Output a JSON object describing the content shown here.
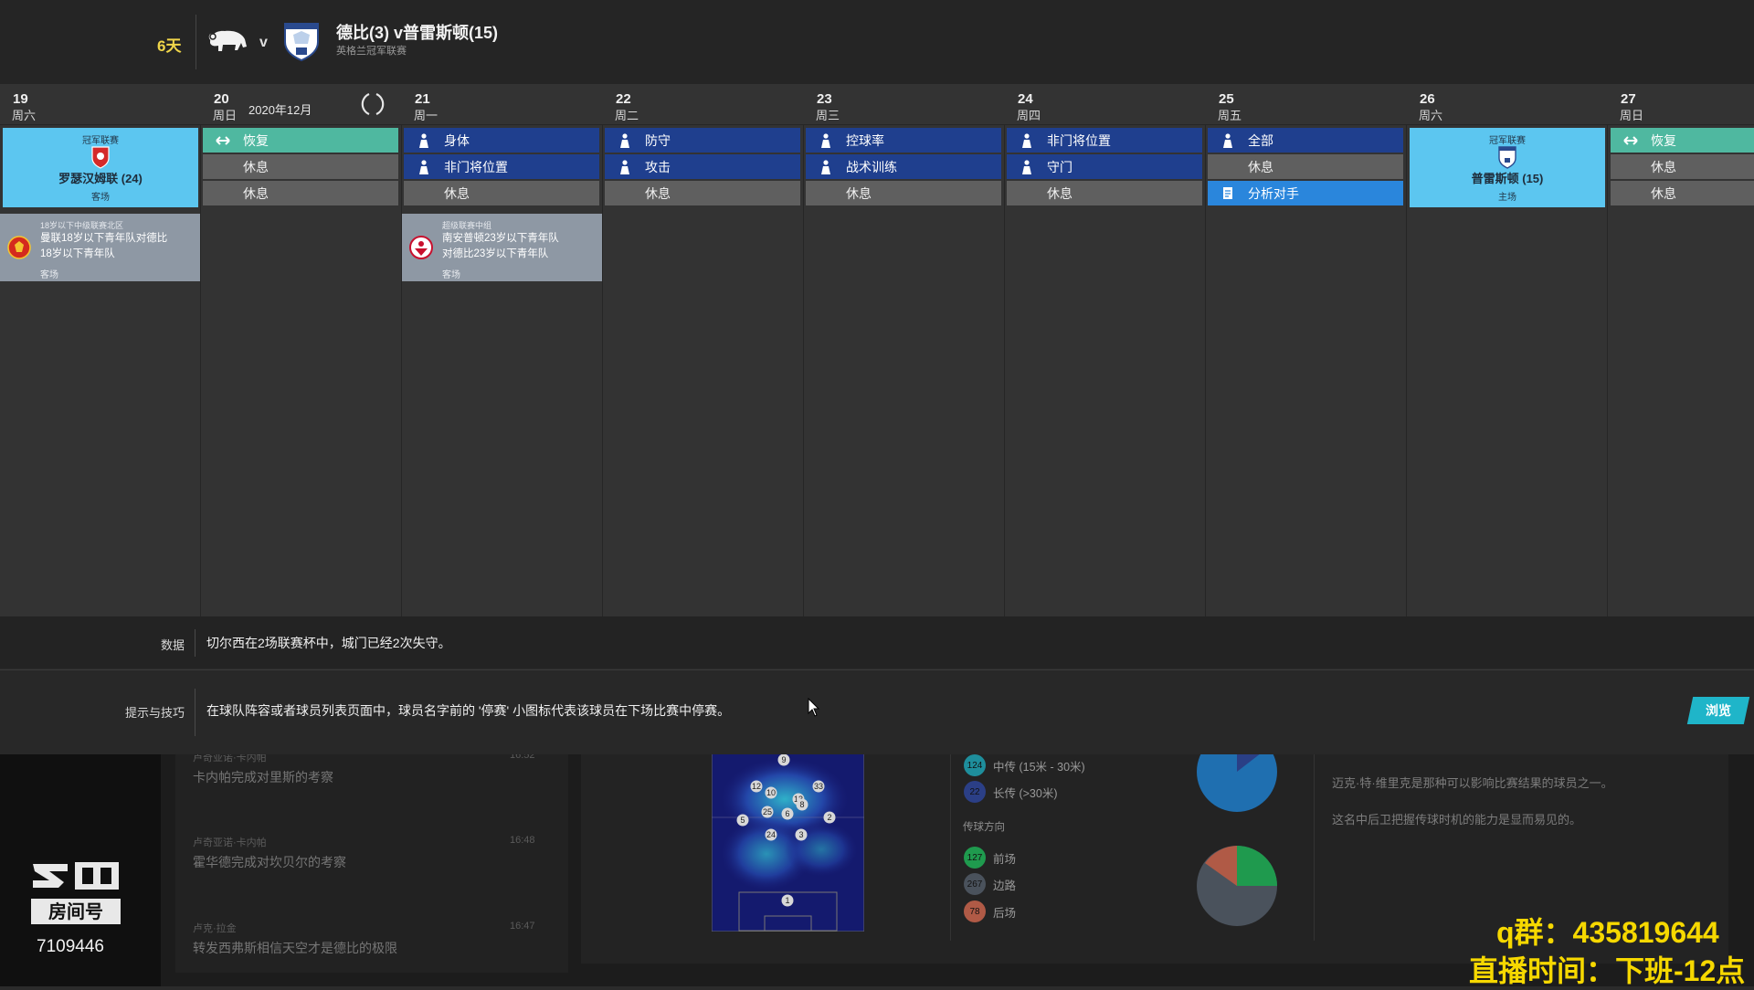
{
  "header": {
    "days_left": "6天",
    "vs": "v",
    "match_title": "德比(3) v普雷斯顿(15)",
    "competition": "英格兰冠军联赛"
  },
  "calendar": {
    "month": "2020年12月",
    "days": [
      {
        "num": "19",
        "weekday": "周六"
      },
      {
        "num": "20",
        "weekday": "周日"
      },
      {
        "num": "21",
        "weekday": "周一"
      },
      {
        "num": "22",
        "weekday": "周二"
      },
      {
        "num": "23",
        "weekday": "周三"
      },
      {
        "num": "24",
        "weekday": "周四"
      },
      {
        "num": "25",
        "weekday": "周五"
      },
      {
        "num": "26",
        "weekday": "周六"
      },
      {
        "num": "27",
        "weekday": "周日"
      }
    ],
    "match_19": {
      "comp": "冠军联赛",
      "opponent": "罗瑟汉姆联 (24)",
      "venue": "客场"
    },
    "match_26": {
      "comp": "冠军联赛",
      "opponent": "普雷斯顿 (15)",
      "venue": "主场"
    },
    "day20": [
      "恢复",
      "休息",
      "休息"
    ],
    "day21": [
      "身体",
      "非门将位置",
      "休息"
    ],
    "day22": [
      "防守",
      "攻击",
      "休息"
    ],
    "day23": [
      "控球率",
      "战术训练",
      "休息"
    ],
    "day24": [
      "非门将位置",
      "守门",
      "休息"
    ],
    "day25": [
      "全部",
      "休息",
      "分析对手"
    ],
    "day27": [
      "恢复",
      "休息",
      "休息"
    ],
    "youth_19": {
      "comp": "18岁以下中级联赛北区",
      "line1": "曼联18岁以下青年队对德比",
      "line2": "18岁以下青年队",
      "venue": "客场"
    },
    "youth_21": {
      "comp": "超级联赛中组",
      "line1": "南安普顿23岁以下青年队",
      "line2": "对德比23岁以下青年队",
      "venue": "客场"
    }
  },
  "data_bar": {
    "label": "数据",
    "text": "切尔西在2场联赛杯中，城门已经2次失守。"
  },
  "tips_bar": {
    "label": "提示与技巧",
    "text": "在球队阵容或者球员列表页面中，球员名字前的 '停赛' 小图标代表该球员在下场比赛中停赛。",
    "browse": "浏览"
  },
  "background": {
    "news": [
      {
        "source": "卢奇亚诺·卡内帕",
        "text": "卡内帕完成对里斯的考察",
        "time": "16:52"
      },
      {
        "source": "卢奇亚诺·卡内帕",
        "text": "霍华德完成对坎贝尔的考察",
        "time": "16:48"
      },
      {
        "source": "卢克·拉金",
        "text": "转发西弗斯相信天空才是德比的极限",
        "time": "16:47"
      }
    ],
    "pass_stats": [
      {
        "num": "124",
        "label": "中传 (15米 - 30米)",
        "color": "#1e8e9c"
      },
      {
        "num": "22",
        "label": "长传 (>30米)",
        "color": "#2b3f86"
      }
    ],
    "direction_head": "传球方向",
    "direction_stats": [
      {
        "num": "127",
        "label": "前场",
        "color": "#1f9a4e"
      },
      {
        "num": "267",
        "label": "边路",
        "color": "#4a525c"
      },
      {
        "num": "78",
        "label": "后场",
        "color": "#b05a46"
      }
    ],
    "right_text1": "迈克·特·维里克是那种可以影响比赛结果的球员之一。",
    "right_text2": "这名中后卫把握传球时机的能力是显而易见的。",
    "heatmap_numbers": [
      "9",
      "12",
      "10",
      "13",
      "33",
      "8",
      "25",
      "6",
      "5",
      "2",
      "24",
      "3",
      "1"
    ]
  },
  "overlay": {
    "room_number": "7109446",
    "qq_group": "q群：435819644",
    "stream_time": "直播时间：下班-12点"
  },
  "colors": {
    "match_card": "#5cc6f0",
    "training_blue": "#1f3f8e",
    "recovery_teal": "#4fb8a0",
    "rest_gray": "#5f5f5f",
    "analyze_blue": "#2a86dc",
    "accent_yellow": "#f6d800"
  }
}
